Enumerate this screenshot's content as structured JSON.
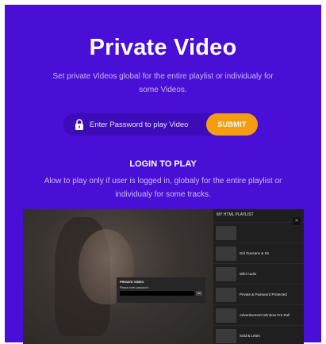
{
  "header": {
    "title": "Private Video",
    "subtitle": "Set private Videos global for the entire playlist or individualy for some Videos."
  },
  "password": {
    "placeholder": "Enter Password to play Video",
    "submit_label": "SUBMIT"
  },
  "login": {
    "title": "LOGIN TO PLAY",
    "description": "Alow to play only if user is logged in, globaly for the entire playlist or individualy for some tracks."
  },
  "player": {
    "dialog": {
      "title": "PRIVATE VIDEO",
      "label": "Please enter password:",
      "ok_label": "OK"
    },
    "playlist": {
      "header": "MY HTML PLAYLIST",
      "close_label": "✕",
      "items": [
        {
          "name": "",
          "sub": ""
        },
        {
          "name": "Girl Duncans & Sit",
          "sub": ""
        },
        {
          "name": "Wild Audio",
          "sub": ""
        },
        {
          "name": "Private & Password Protected",
          "sub": ""
        },
        {
          "name": "Advertisement Window Pre Roll",
          "sub": ""
        },
        {
          "name": "Sold & Learn",
          "sub": ""
        }
      ]
    }
  },
  "colors": {
    "background": "#4a0fd6",
    "accent": "#f59d10",
    "input_bg": "#3d0bb7"
  }
}
